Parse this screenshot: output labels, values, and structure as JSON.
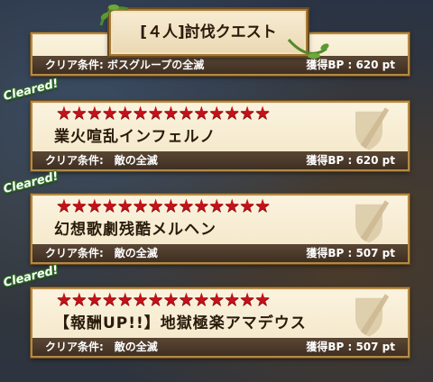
{
  "header": {
    "title": "[４人]討伐クエスト"
  },
  "cleared_label": "Cleared!",
  "colors": {
    "star": "#c3121a",
    "bar": "#3f2f22",
    "cleared_outline": "#2d6e22",
    "frame": "#b48a44"
  },
  "quests": [
    {
      "title": "",
      "stars": "",
      "condition": "クリア条件: ボスグループの全滅",
      "bp": "獲得BP : 620 pt",
      "cleared": false
    },
    {
      "title": "業火喧乱インフェルノ",
      "stars": "★★★★★★★★★★★★★★",
      "condition": "クリア条件:　敵の全滅",
      "bp": "獲得BP : 620 pt",
      "cleared": true
    },
    {
      "title": "幻想歌劇残酷メルヘン",
      "stars": "★★★★★★★★★★★★★★",
      "condition": "クリア条件:　敵の全滅",
      "bp": "獲得BP : 507 pt",
      "cleared": true
    },
    {
      "title": "【報酬UP!!】地獄極楽アマデウス",
      "stars": "★★★★★★★★★★★★★★",
      "condition": "クリア条件:　敵の全滅",
      "bp": "獲得BP : 507 pt",
      "cleared": true
    }
  ]
}
